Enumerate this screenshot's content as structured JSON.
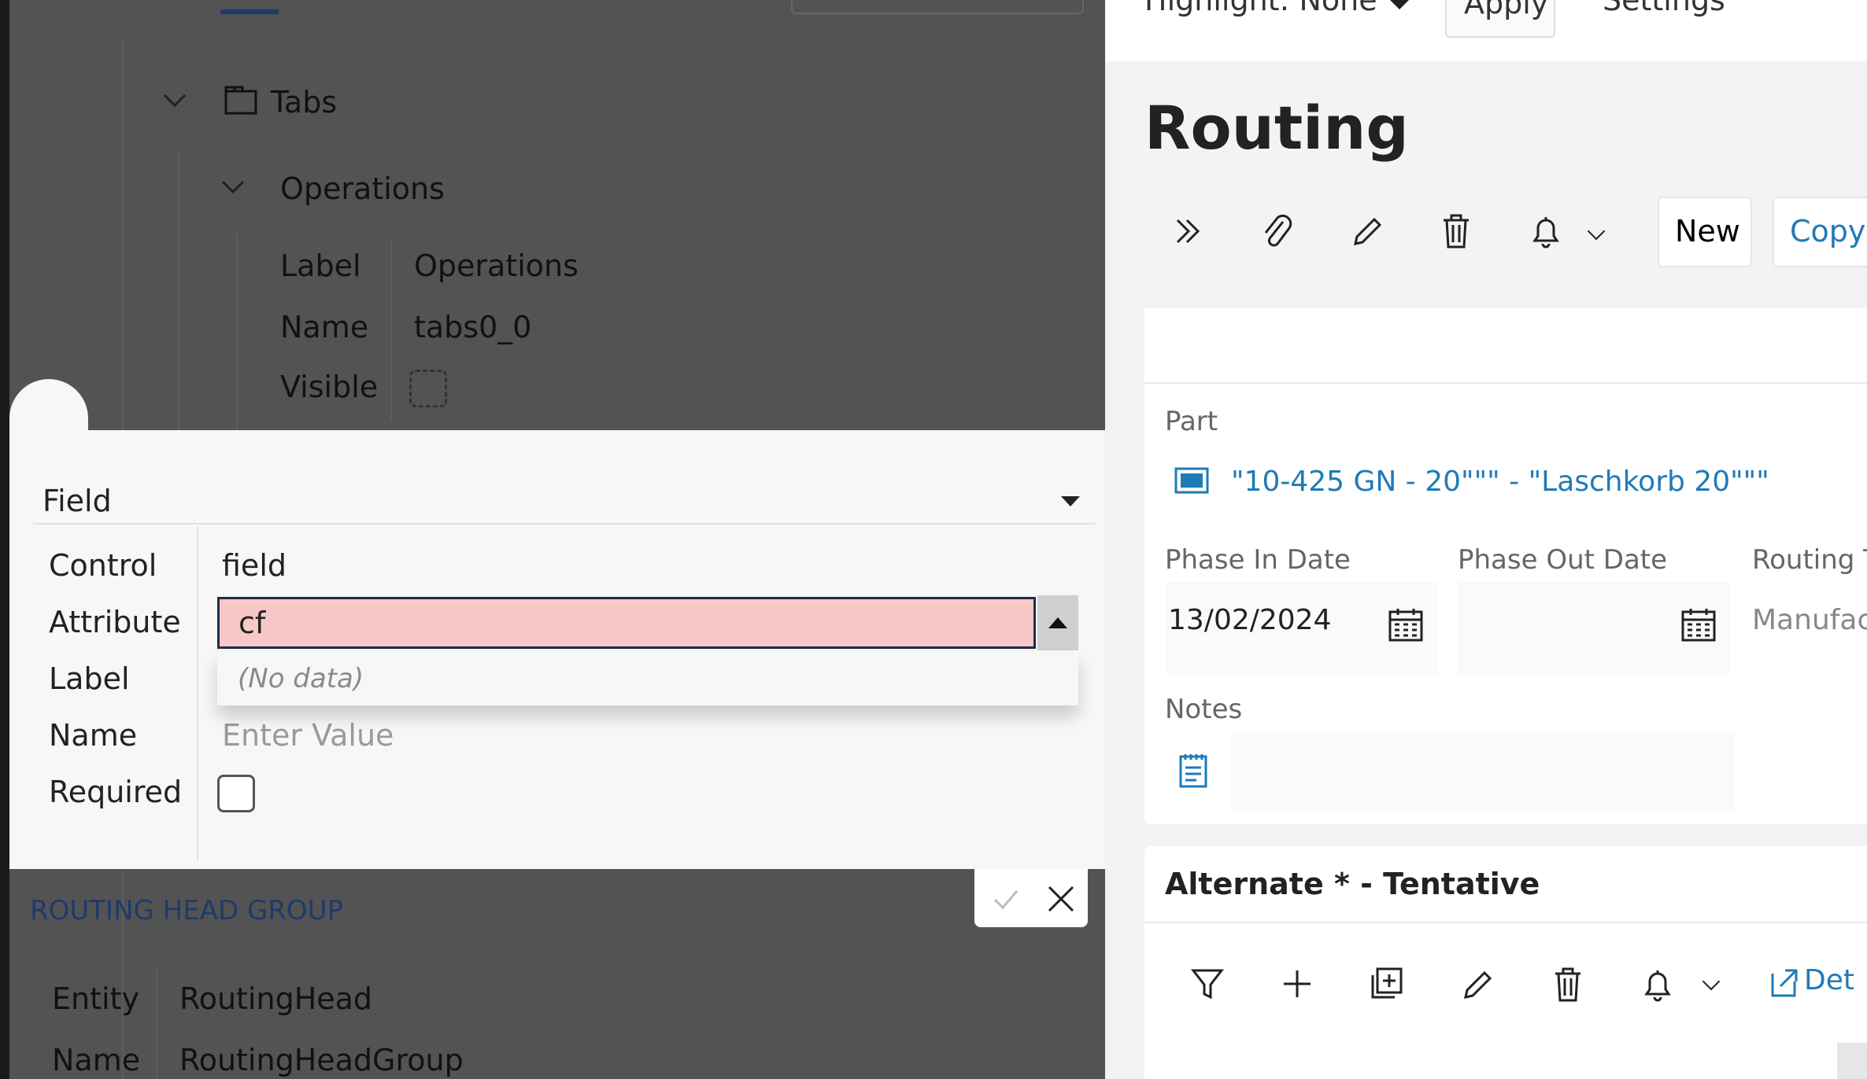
{
  "designer": {
    "tree_tabs": "Tabs",
    "tree_operations": "Operations",
    "props": [
      {
        "label": "Label",
        "value": "Operations"
      },
      {
        "label": "Name",
        "value": "tabs0_0"
      },
      {
        "label": "Visible",
        "value": ""
      }
    ],
    "group_title": "ROUTING HEAD GROUP",
    "group_props": [
      {
        "label": "Entity",
        "value": "RoutingHead"
      },
      {
        "label": "Name",
        "value": "RoutingHeadGroup"
      }
    ]
  },
  "field_editor": {
    "section": "Field",
    "labels": {
      "control": "Control",
      "attribute": "Attribute",
      "label": "Label",
      "name": "Name",
      "required": "Required"
    },
    "control_value": "field",
    "attribute_value": "cf",
    "dropdown_empty": "(No data)",
    "name_placeholder": "Enter Value",
    "required_checked": false
  },
  "app": {
    "topbar": {
      "highlight": "Highlight: None",
      "apply": "Apply",
      "settings": "Settings"
    },
    "title": "Routing",
    "toolbar": {
      "new": "New",
      "copy": "Copy"
    },
    "part_label": "Part",
    "part_value": "\"10-425 GN - 20\"\"\" - \"Laschkorb 20\"\"\"",
    "phase_in_label": "Phase In Date",
    "phase_in_value": "13/02/2024",
    "phase_out_label": "Phase Out Date",
    "phase_out_value": "",
    "routing_type_label": "Routing T",
    "routing_type_value": "Manufac",
    "notes_label": "Notes",
    "alternate_title": "Alternate * - Tentative",
    "details_link": "Det"
  },
  "colors": {
    "accent": "#1f7ab8",
    "invalid_input": "#f8c8c8",
    "overlay": "#535353"
  }
}
